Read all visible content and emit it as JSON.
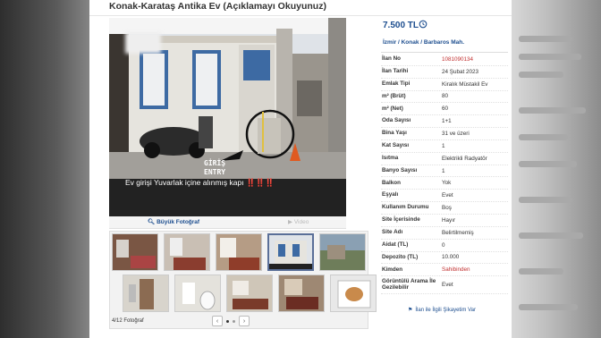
{
  "listing": {
    "title": "Konak-Karataş Antika Ev (Açıklamayı Okuyunuz)",
    "price": "7.500 TL",
    "location": "İzmir  /  Konak  /  Barbaros Mah."
  },
  "photo": {
    "caption": "Ev girişi Yuvarlak içine alınmış kapı ‼️‼️‼️",
    "entry_line1": "GİRİŞ",
    "entry_line2": "ENTRY",
    "big_photo_label": "Büyük Fotoğraf",
    "video_label": "Video",
    "counter": "4/12 Fotoğraf"
  },
  "specs": [
    {
      "key": "İlan No",
      "value": "1081090134",
      "color": "#c12f2f"
    },
    {
      "key": "İlan Tarihi",
      "value": "24 Şubat 2023"
    },
    {
      "key": "Emlak Tipi",
      "value": "Kiralık Müstakil Ev"
    },
    {
      "key": "m² (Brüt)",
      "value": "80"
    },
    {
      "key": "m² (Net)",
      "value": "60"
    },
    {
      "key": "Oda Sayısı",
      "value": "1+1"
    },
    {
      "key": "Bina Yaşı",
      "value": "31 ve üzeri"
    },
    {
      "key": "Kat Sayısı",
      "value": "1"
    },
    {
      "key": "Isıtma",
      "value": "Elektrikli Radyatör"
    },
    {
      "key": "Banyo Sayısı",
      "value": "1"
    },
    {
      "key": "Balkon",
      "value": "Yok"
    },
    {
      "key": "Eşyalı",
      "value": "Evet"
    },
    {
      "key": "Kullanım Durumu",
      "value": "Boş"
    },
    {
      "key": "Site İçerisinde",
      "value": "Hayır"
    },
    {
      "key": "Site Adı",
      "value": "Belirtilmemiş"
    },
    {
      "key": "Aidat (TL)",
      "value": "0"
    },
    {
      "key": "Depozito (TL)",
      "value": "10.000"
    },
    {
      "key": "Kimden",
      "value": "Sahibinden",
      "color": "#c12f2f"
    },
    {
      "key": "Görüntülü Arama İle Gezilebilir",
      "value": "Evet"
    }
  ],
  "complaint": "İlan ile İlgili Şikayetim Var",
  "colors": {
    "brand_blue": "#1d4e8f",
    "accent_red": "#c12f2f"
  }
}
